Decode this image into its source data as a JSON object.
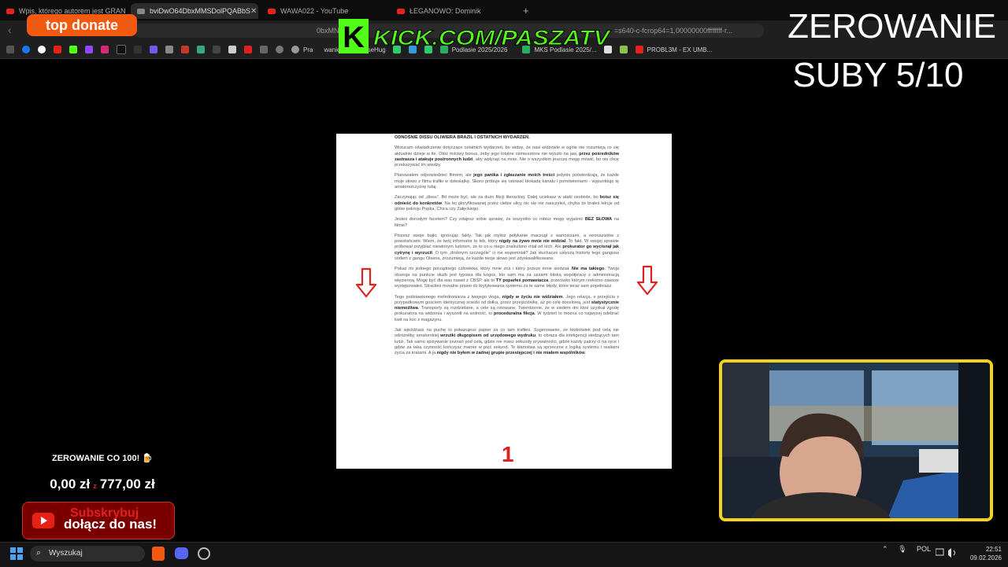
{
  "browser": {
    "tabs": [
      {
        "title": "Wpis, którego autorem jest GRANDE",
        "active": false
      },
      {
        "title": "bviDwO64DbxMMSDolPQABbS",
        "active": true
      },
      {
        "title": "WAWA022 - YouTube",
        "active": false
      },
      {
        "title": "ŁEGANOWO: Dominik",
        "active": false
      }
    ],
    "address": "0bxMN",
    "address_tail": "=s640-c-fcrop64=1,00000000ffffffff-r...",
    "bookmarks": [
      "Pra",
      "wanie",
      "CaseHug",
      "Podlasie 2025/2026",
      "MKS Podlasie 2025/...",
      "PROBL3M - EX UMB..."
    ]
  },
  "overlay": {
    "top_donate": "top donate",
    "kick": "KICK.COM/PASZATV",
    "zero_title": "ZEROWANIE",
    "zero_count": "SUBY 5/10"
  },
  "document": {
    "heading": "ODNOŚNIE DISSU OLIWIERA BRAZIL I OSTATNICH WYDARZEŃ.",
    "paragraphs": [
      [
        "Wrzucam oświadczenie dotyczące ostatnich wydarzeń, bo widzę, że nasi widzowie w ogóle nie rozumieją co się aktualnie dzieje w tle. Otóż mściwy bonus, żeby jego totalne ośmieszenie nie wyszło na jaw, ",
        "przez pośredników zastrasza i atakuje postronnych ludzi",
        ", aby wpłynąć na mnie. Nie o wszystkim jeszcze mogę mówić, bo nie chcę przekazywać im wiedzy."
      ],
      [
        "Planowałem odpowiedzieć filmem, ale ",
        "jego panika i zgłaszanie moich treści",
        " jedynie potwierdzają, że każde moje słowo z filmu trafiło w dziesiątkę. Skoro próbuje się ratować blokadą kanału i pomówieniami - wypunktuję tę amatorszczyznę tutaj."
      ],
      [
        "Zaczynając od „dissu\". Bit może być, ale za dużo fikcji literackiej. Dalej uciekasz w ataki osobiste, bo ",
        "boisz się odnieść do konkretów",
        ". Na tej gloryfikowanej przez ciebie ulicy nic się nie nauczyłeś, chyba że brałeś lekcje od gitów pokroju Popka, Chica czy Załęckiego."
      ],
      [
        "Jesteś dorosłym facetem? Czy zdajesz sobie sprawę, że wszystko co robisz mogę wyjaśnić ",
        "BEZ SŁOWA",
        " na filmie?"
      ],
      [
        "Piszesz swoje bajki, ignorując fakty. Tak jak mylisz połykanie maczugi z wartościami, a neonazistów z powstańcami. Wiem, że twój informator to teb, który ",
        "nigdy na żywo mnie nie widział",
        ". To fakt. W swojej sprawie próbował przyjbiać niewinnym ludziom, że to co u niego znaleziono miał od nich. Ale ",
        "prokurator go wycisnął jak cytrynę i wyrzucił",
        ". O tym „drobnym szczególe\" ci nie wspomniał? Jak słuchacze usłyszą historię tego gangusa sodem z gangu Olsena, zrozumieją, że każde twoje słowo jest zdyskwalifikowane."
      ],
      [
        "Pokaż mi jednego porządnego człowieka, który mnie zna i który przeze mnie siedział. ",
        "Nie ma takiego",
        ". Twoja obsesja na punkcie służb jest typowa dla kogoś, kto sam ma za uszami bliską współpracę z administracją więzienną. Mogę być dla was nawet z CBŚP, ale to ",
        "TY poparłeś pomawiacza",
        ", przeciwko którym rzekomo zawsze występowałeś. Straciłeś moralne prawo do krytykowania systemu za te same błędy, które teraz sam popełniasz."
      ],
      [
        "Tego podstawionego mefedroniarza z twojego vloga, ",
        "nigdy w życiu nie widziałem",
        ". Jego relacja, o przejściu z przypadkowym gościem identycznej ścieżki od dołka, przez przejściówkę, aż po celę docelową, jest ",
        "statystycznie niemożliwa",
        ". Transporty są rozdzielane, a cele są rotowane. Twierdzenie, że w siedem dni ktoś uzyskał zgodę prokuratora na widzenia i wyszedł na wolność, to ",
        "proceduralna fikcja",
        ". W tydzień to można co najwyżej odebrać kwit na koc z magazynu."
      ],
      [
        "Jak wjeżdżasz na puchę to pokazujesz papier za co tam trafiłeś. Sugerowanie, że ktokolwiek pod celą nie odróżniłby amatorskiej ",
        "wrzutki długopisem od urzędowego wydruku",
        ", to obraza dla inteligencji siedzących tam ludzi. Tak samo spisywanie zeznań pod celą, gdzie nie masz sekundy prywatności, gdzie każdy patrzy ci na ręce i gdzie za taką czynność kończysz marnie w pięć sekund. Te kłamstwa są sprzeczne z logiką systemu i realiami życia za kratami. A ja ",
        "nigdy nie byłem w żadnej grupie przestępczej i nie miałem wspólników",
        "."
      ]
    ],
    "page_number": "1"
  },
  "widgets": {
    "goal_title": "ZEROWANIE CO 100! 🍺",
    "goal_current": "0,00 zł",
    "goal_sep": "z",
    "goal_target": "777,00 zł",
    "sub_label": "Subskrybuj",
    "sub_join": "dołącz do nas!"
  },
  "taskbar": {
    "search_placeholder": "Wyszukaj",
    "lang": "POL",
    "time": "22:51",
    "date": "09.02.2026"
  }
}
